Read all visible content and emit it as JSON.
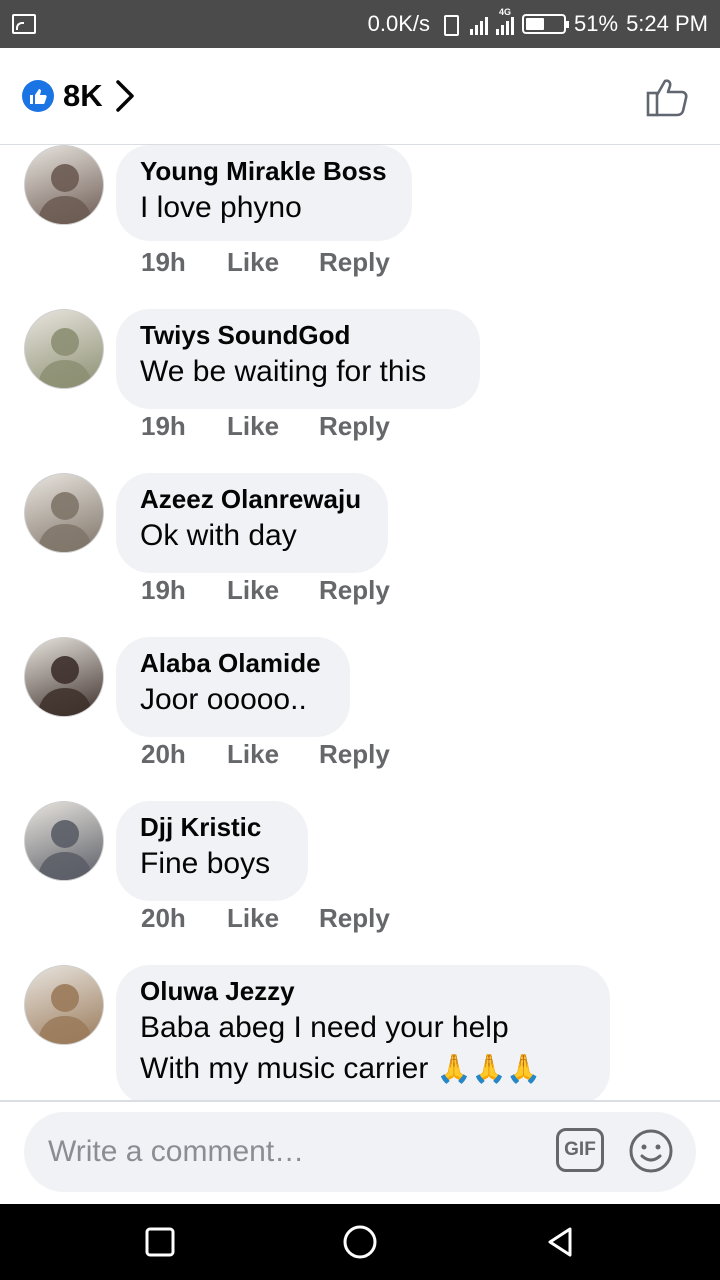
{
  "status_bar": {
    "net_speed": "0.0K/s",
    "network_type": "4G",
    "battery_percent": "51%",
    "battery_level": 0.51,
    "time": "5:24 PM",
    "icons": [
      "cast-icon",
      "vibrate-icon",
      "signal-icon",
      "battery-icon"
    ]
  },
  "header": {
    "reaction_count": "8K",
    "icons": [
      "like-reaction-icon",
      "chevron-right-icon",
      "thumbs-up-outline-icon"
    ]
  },
  "comments": [
    {
      "author": "Young Mirakle Boss",
      "lines": [
        "I love phyno"
      ],
      "time": "19h",
      "like": "Like",
      "reply": "Reply",
      "avatar_color": "#6b5a52"
    },
    {
      "author": "Twiys SoundGod",
      "lines": [
        "We be waiting for this"
      ],
      "time": "19h",
      "like": "Like",
      "reply": "Reply",
      "avatar_color": "#8c8f72"
    },
    {
      "author": "Azeez Olanrewaju",
      "lines": [
        "Ok with day"
      ],
      "time": "19h",
      "like": "Like",
      "reply": "Reply",
      "avatar_color": "#7f7468"
    },
    {
      "author": "Alaba Olamide",
      "lines": [
        "Joor ooooo.."
      ],
      "time": "20h",
      "like": "Like",
      "reply": "Reply",
      "avatar_color": "#3d2f2a"
    },
    {
      "author": "Djj Kristic",
      "lines": [
        "Fine boys"
      ],
      "time": "20h",
      "like": "Like",
      "reply": "Reply",
      "avatar_color": "#5a5d66"
    },
    {
      "author": "Oluwa Jezzy",
      "lines": [
        "Baba abeg I need your help",
        "With my music carrier"
      ],
      "emoji": "🙏🙏🙏",
      "avatar_color": "#9a7a5a"
    }
  ],
  "composer": {
    "placeholder": "Write a comment…",
    "gif_label": "GIF"
  },
  "nav_bar": {
    "icons": [
      "recents-square-icon",
      "home-circle-icon",
      "back-triangle-icon"
    ]
  },
  "colors": {
    "status_bar_bg": "#4b4b4b",
    "bubble_bg": "#f0f2f5",
    "meta_text": "#65676b",
    "like_blue": "#1b74e4"
  }
}
